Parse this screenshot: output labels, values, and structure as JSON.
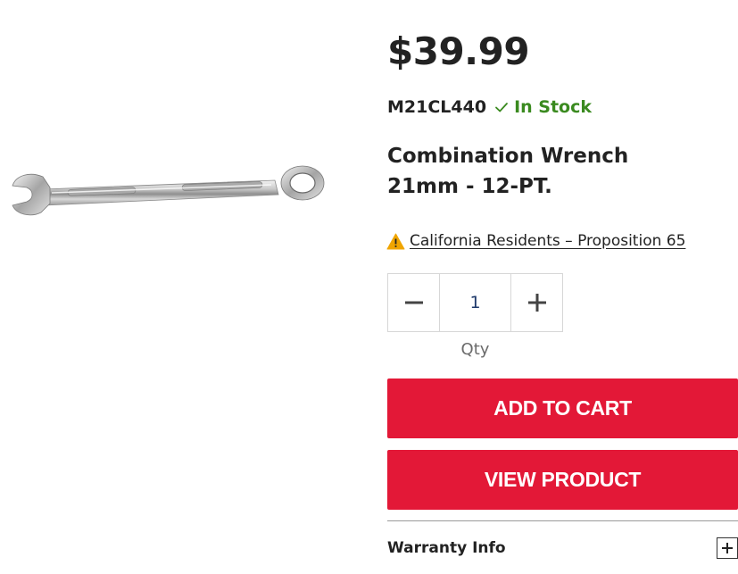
{
  "product": {
    "price": "$39.99",
    "sku": "M21CL440",
    "stock_status": "In Stock",
    "title_line1": "Combination Wrench",
    "title_line2": "21mm - 12-PT.",
    "image_icon": "combination-wrench-image"
  },
  "notice": {
    "icon": "warning-icon",
    "link_text": "California Residents – Proposition 65"
  },
  "quantity": {
    "value": "1",
    "label": "Qty",
    "decrement_icon": "minus-icon",
    "increment_icon": "plus-icon"
  },
  "actions": {
    "add_to_cart": "ADD TO CART",
    "view_product": "VIEW PRODUCT"
  },
  "warranty": {
    "label": "Warranty Info",
    "expand_icon": "plus-icon"
  },
  "colors": {
    "accent_red": "#e31837",
    "in_stock_green": "#3a8a1f",
    "warning_orange": "#f0a500"
  }
}
